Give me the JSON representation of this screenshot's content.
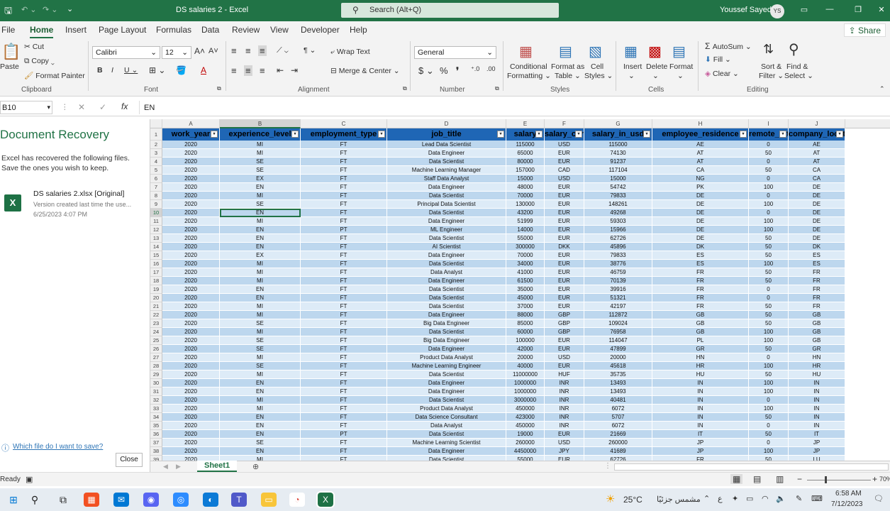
{
  "titlebar": {
    "title": "DS salaries 2 - Excel",
    "search_placeholder": "Search (Alt+Q)",
    "user": "Youssef Sayed",
    "initials": "YS"
  },
  "tabs": [
    "File",
    "Home",
    "Insert",
    "Page Layout",
    "Formulas",
    "Data",
    "Review",
    "View",
    "Developer",
    "Help"
  ],
  "active_tab": "Home",
  "share": "Share",
  "ribbon": {
    "clipboard": {
      "paste": "Paste",
      "cut": "Cut",
      "copy": "Copy",
      "format_painter": "Format Painter",
      "label": "Clipboard"
    },
    "font": {
      "name": "Calibri",
      "size": "12",
      "label": "Font"
    },
    "alignment": {
      "wrap": "Wrap Text",
      "merge": "Merge & Center",
      "label": "Alignment"
    },
    "number": {
      "format": "General",
      "label": "Number"
    },
    "styles": {
      "cond": "Conditional",
      "cond2": "Formatting",
      "fmt_table": "Format as",
      "fmt_table2": "Table",
      "cell": "Cell",
      "cell2": "Styles",
      "label": "Styles"
    },
    "cells": {
      "insert": "Insert",
      "delete": "Delete",
      "format": "Format",
      "label": "Cells"
    },
    "editing": {
      "autosum": "AutoSum",
      "fill": "Fill",
      "clear": "Clear",
      "sort": "Sort &",
      "sort2": "Filter",
      "find": "Find &",
      "find2": "Select",
      "label": "Editing"
    }
  },
  "formula_bar": {
    "cell_ref": "B10",
    "value": "EN"
  },
  "recovery": {
    "title": "Document Recovery",
    "message": "Excel has recovered the following files. Save the ones you wish to keep.",
    "file_name": "DS salaries 2.xlsx  [Original]",
    "file_desc": "Version created last time the use...",
    "file_date": "6/25/2023 4:07 PM",
    "help_link": "Which file do I want to save?",
    "close": "Close"
  },
  "columns": [
    "A",
    "B",
    "C",
    "D",
    "E",
    "F",
    "G",
    "H",
    "I",
    "J"
  ],
  "headers": [
    "work_year",
    "experience_level",
    "employment_type",
    "job_title",
    "salary",
    "salary_currency",
    "salary_in_usd",
    "employee_residence",
    "remote_ratio",
    "company_location"
  ],
  "rows": [
    [
      "2020",
      "MI",
      "FT",
      "Lead Data Scientist",
      "115000",
      "USD",
      "115000",
      "AE",
      "0",
      "AE"
    ],
    [
      "2020",
      "MI",
      "FT",
      "Data Engineer",
      "65000",
      "EUR",
      "74130",
      "AT",
      "50",
      "AT"
    ],
    [
      "2020",
      "SE",
      "FT",
      "Data Scientist",
      "80000",
      "EUR",
      "91237",
      "AT",
      "0",
      "AT"
    ],
    [
      "2020",
      "SE",
      "FT",
      "Machine Learning Manager",
      "157000",
      "CAD",
      "117104",
      "CA",
      "50",
      "CA"
    ],
    [
      "2020",
      "EX",
      "FT",
      "Staff Data Analyst",
      "15000",
      "USD",
      "15000",
      "NG",
      "0",
      "CA"
    ],
    [
      "2020",
      "EN",
      "FT",
      "Data Engineer",
      "48000",
      "EUR",
      "54742",
      "PK",
      "100",
      "DE"
    ],
    [
      "2020",
      "MI",
      "FT",
      "Data Scientist",
      "70000",
      "EUR",
      "79833",
      "DE",
      "0",
      "DE"
    ],
    [
      "2020",
      "SE",
      "FT",
      "Principal Data Scientist",
      "130000",
      "EUR",
      "148261",
      "DE",
      "100",
      "DE"
    ],
    [
      "2020",
      "EN",
      "FT",
      "Data Scientist",
      "43200",
      "EUR",
      "49268",
      "DE",
      "0",
      "DE"
    ],
    [
      "2020",
      "MI",
      "FT",
      "Data Engineer",
      "51999",
      "EUR",
      "59303",
      "DE",
      "100",
      "DE"
    ],
    [
      "2020",
      "EN",
      "PT",
      "ML Engineer",
      "14000",
      "EUR",
      "15966",
      "DE",
      "100",
      "DE"
    ],
    [
      "2020",
      "EN",
      "FT",
      "Data Scientist",
      "55000",
      "EUR",
      "62726",
      "DE",
      "50",
      "DE"
    ],
    [
      "2020",
      "EN",
      "FT",
      "AI Scientist",
      "300000",
      "DKK",
      "45896",
      "DK",
      "50",
      "DK"
    ],
    [
      "2020",
      "EX",
      "FT",
      "Data Engineer",
      "70000",
      "EUR",
      "79833",
      "ES",
      "50",
      "ES"
    ],
    [
      "2020",
      "MI",
      "FT",
      "Data Scientist",
      "34000",
      "EUR",
      "38776",
      "ES",
      "100",
      "ES"
    ],
    [
      "2020",
      "MI",
      "FT",
      "Data Analyst",
      "41000",
      "EUR",
      "46759",
      "FR",
      "50",
      "FR"
    ],
    [
      "2020",
      "MI",
      "FT",
      "Data Engineer",
      "61500",
      "EUR",
      "70139",
      "FR",
      "50",
      "FR"
    ],
    [
      "2020",
      "EN",
      "FT",
      "Data Scientist",
      "35000",
      "EUR",
      "39916",
      "FR",
      "0",
      "FR"
    ],
    [
      "2020",
      "EN",
      "FT",
      "Data Scientist",
      "45000",
      "EUR",
      "51321",
      "FR",
      "0",
      "FR"
    ],
    [
      "2020",
      "MI",
      "FT",
      "Data Scientist",
      "37000",
      "EUR",
      "42197",
      "FR",
      "50",
      "FR"
    ],
    [
      "2020",
      "MI",
      "FT",
      "Data Engineer",
      "88000",
      "GBP",
      "112872",
      "GB",
      "50",
      "GB"
    ],
    [
      "2020",
      "SE",
      "FT",
      "Big Data Engineer",
      "85000",
      "GBP",
      "109024",
      "GB",
      "50",
      "GB"
    ],
    [
      "2020",
      "MI",
      "FT",
      "Data Scientist",
      "60000",
      "GBP",
      "76958",
      "GB",
      "100",
      "GB"
    ],
    [
      "2020",
      "SE",
      "FT",
      "Big Data Engineer",
      "100000",
      "EUR",
      "114047",
      "PL",
      "100",
      "GB"
    ],
    [
      "2020",
      "SE",
      "FT",
      "Data Engineer",
      "42000",
      "EUR",
      "47899",
      "GR",
      "50",
      "GR"
    ],
    [
      "2020",
      "MI",
      "FT",
      "Product Data Analyst",
      "20000",
      "USD",
      "20000",
      "HN",
      "0",
      "HN"
    ],
    [
      "2020",
      "SE",
      "FT",
      "Machine Learning Engineer",
      "40000",
      "EUR",
      "45618",
      "HR",
      "100",
      "HR"
    ],
    [
      "2020",
      "MI",
      "FT",
      "Data Scientist",
      "11000000",
      "HUF",
      "35735",
      "HU",
      "50",
      "HU"
    ],
    [
      "2020",
      "EN",
      "FT",
      "Data Engineer",
      "1000000",
      "INR",
      "13493",
      "IN",
      "100",
      "IN"
    ],
    [
      "2020",
      "EN",
      "FT",
      "Data Engineer",
      "1000000",
      "INR",
      "13493",
      "IN",
      "100",
      "IN"
    ],
    [
      "2020",
      "MI",
      "FT",
      "Data Scientist",
      "3000000",
      "INR",
      "40481",
      "IN",
      "0",
      "IN"
    ],
    [
      "2020",
      "MI",
      "FT",
      "Product Data Analyst",
      "450000",
      "INR",
      "6072",
      "IN",
      "100",
      "IN"
    ],
    [
      "2020",
      "EN",
      "FT",
      "Data Science Consultant",
      "423000",
      "INR",
      "5707",
      "IN",
      "50",
      "IN"
    ],
    [
      "2020",
      "EN",
      "FT",
      "Data Analyst",
      "450000",
      "INR",
      "6072",
      "IN",
      "0",
      "IN"
    ],
    [
      "2020",
      "EN",
      "PT",
      "Data Scientist",
      "19000",
      "EUR",
      "21669",
      "IT",
      "50",
      "IT"
    ],
    [
      "2020",
      "SE",
      "FT",
      "Machine Learning Scientist",
      "260000",
      "USD",
      "260000",
      "JP",
      "0",
      "JP"
    ],
    [
      "2020",
      "EN",
      "FT",
      "Data Engineer",
      "4450000",
      "JPY",
      "41689",
      "JP",
      "100",
      "JP"
    ],
    [
      "2020",
      "MI",
      "FT",
      "Data Scientist",
      "55000",
      "EUR",
      "62726",
      "FR",
      "50",
      "LU"
    ]
  ],
  "sheet_tab": "Sheet1",
  "status": {
    "left": "Ready",
    "zoom": "70%"
  },
  "taskbar": {
    "weather": "25°C",
    "weather_desc": "مشمس جزئيًا",
    "time": "6:58 AM",
    "date": "7/12/2023"
  }
}
